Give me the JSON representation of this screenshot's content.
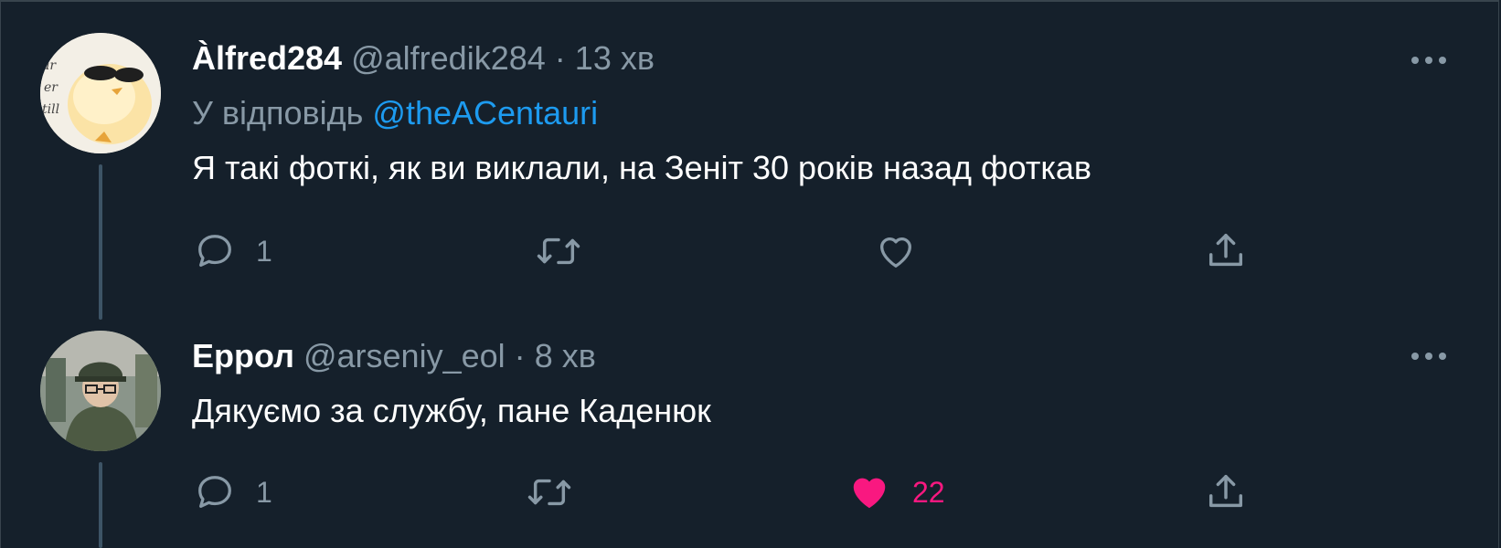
{
  "tweets": [
    {
      "display_name": "Àlfred284",
      "handle": "@alfredik284",
      "separator": "·",
      "time": "13 хв",
      "reply_prefix": "У відповідь",
      "reply_mention": "@theACentauri",
      "text": "Я такі фоткі, як ви виклали, на Зеніт 30 років назад фоткав",
      "reply_count": "1",
      "like_count": "",
      "liked": false,
      "avatar_icon": "chick-with-sunglasses-avatar"
    },
    {
      "display_name": "Еррол",
      "handle": "@arseniy_eol",
      "separator": "·",
      "time": "8 хв",
      "text": "Дякуємо за службу, пане Каденюк",
      "reply_count": "1",
      "like_count": "22",
      "liked": true,
      "avatar_icon": "person-in-cap-avatar"
    }
  ],
  "icons": {
    "reply": "speech-bubble-icon",
    "retweet": "retweet-arrows-icon",
    "like": "heart-icon",
    "share": "share-upload-icon",
    "more": "more-dots-icon"
  },
  "colors": {
    "background": "#15202b",
    "text_primary": "#ffffff",
    "text_secondary": "#8899a6",
    "link": "#1d9bf0",
    "like_active": "#f91880",
    "thread_line": "#3d5466"
  }
}
